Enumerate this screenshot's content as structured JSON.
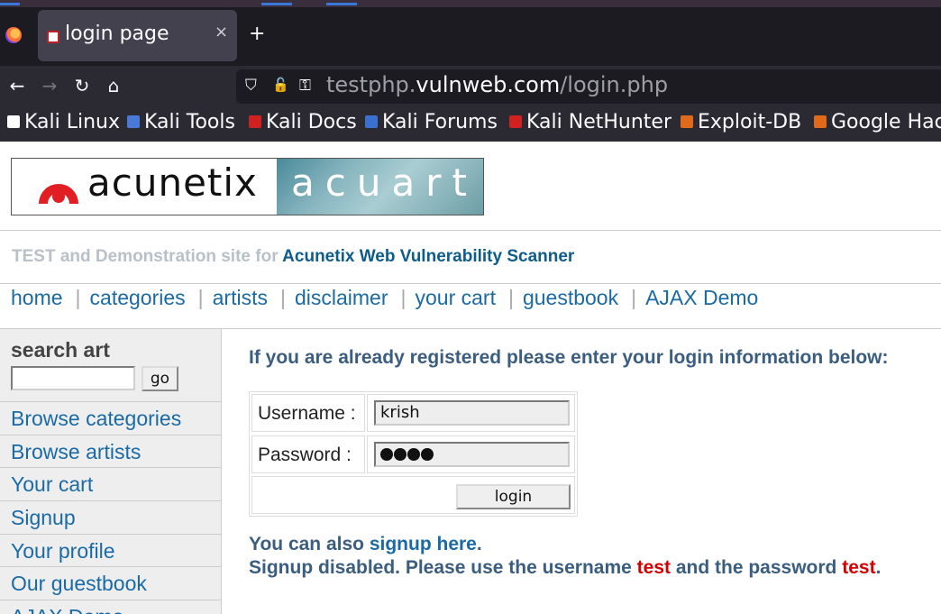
{
  "browser": {
    "tab_title": "login page",
    "tab_close": "×",
    "new_tab": "+",
    "url_prefix": "testphp.",
    "url_domain": "vulnweb.com",
    "url_path": "/login.php",
    "nav": {
      "back": "←",
      "forward": "→",
      "reload": "↻",
      "home": "⌂"
    },
    "url_icons": {
      "shield": "⛉",
      "lock": "🔓",
      "key": "⚿"
    },
    "bookmarks": [
      {
        "label": "Kali Linux",
        "icon_color": "#ffffff"
      },
      {
        "label": "Kali Tools",
        "icon_color": "#4a7ad8"
      },
      {
        "label": "Kali Docs",
        "icon_color": "#d02020"
      },
      {
        "label": "Kali Forums",
        "icon_color": "#3a70d0"
      },
      {
        "label": "Kali NetHunter",
        "icon_color": "#d02020"
      },
      {
        "label": "Exploit-DB",
        "icon_color": "#e06a1a"
      },
      {
        "label": "Google Hac",
        "icon_color": "#e06a1a"
      }
    ]
  },
  "logo": {
    "left_word": "acunetix",
    "right_word": "acuart"
  },
  "tagline": {
    "prefix": "TEST and Demonstration site for ",
    "product": "Acunetix Web Vulnerability Scanner"
  },
  "menu": [
    {
      "label": "home"
    },
    {
      "label": "categories"
    },
    {
      "label": "artists"
    },
    {
      "label": "disclaimer"
    },
    {
      "label": "your cart"
    },
    {
      "label": "guestbook"
    },
    {
      "label": "AJAX Demo"
    }
  ],
  "menu_separator": "|",
  "sidebar": {
    "search_title": "search art",
    "search_value": "",
    "go_label": "go",
    "links": [
      {
        "label": "Browse categories"
      },
      {
        "label": "Browse artists"
      },
      {
        "label": "Your cart"
      },
      {
        "label": "Signup"
      },
      {
        "label": "Your profile"
      },
      {
        "label": "Our guestbook"
      },
      {
        "label": "AJAX Demo"
      }
    ]
  },
  "login": {
    "heading": "If you are already registered please enter your login information below:",
    "username_label": "Username :",
    "username_value": "krish",
    "password_label": "Password :",
    "password_length": 4,
    "login_button": "login"
  },
  "notes": {
    "line1_prefix": "You can also ",
    "line1_link": "signup here",
    "line1_suffix": ".",
    "line2_a": "Signup disabled. Please use the username ",
    "line2_user": "test",
    "line2_b": " and the password ",
    "line2_pass": "test",
    "line2_c": "."
  },
  "colors": {
    "link": "#1a6aa5",
    "heading": "#3a5d80",
    "accent_red": "#d40000"
  }
}
